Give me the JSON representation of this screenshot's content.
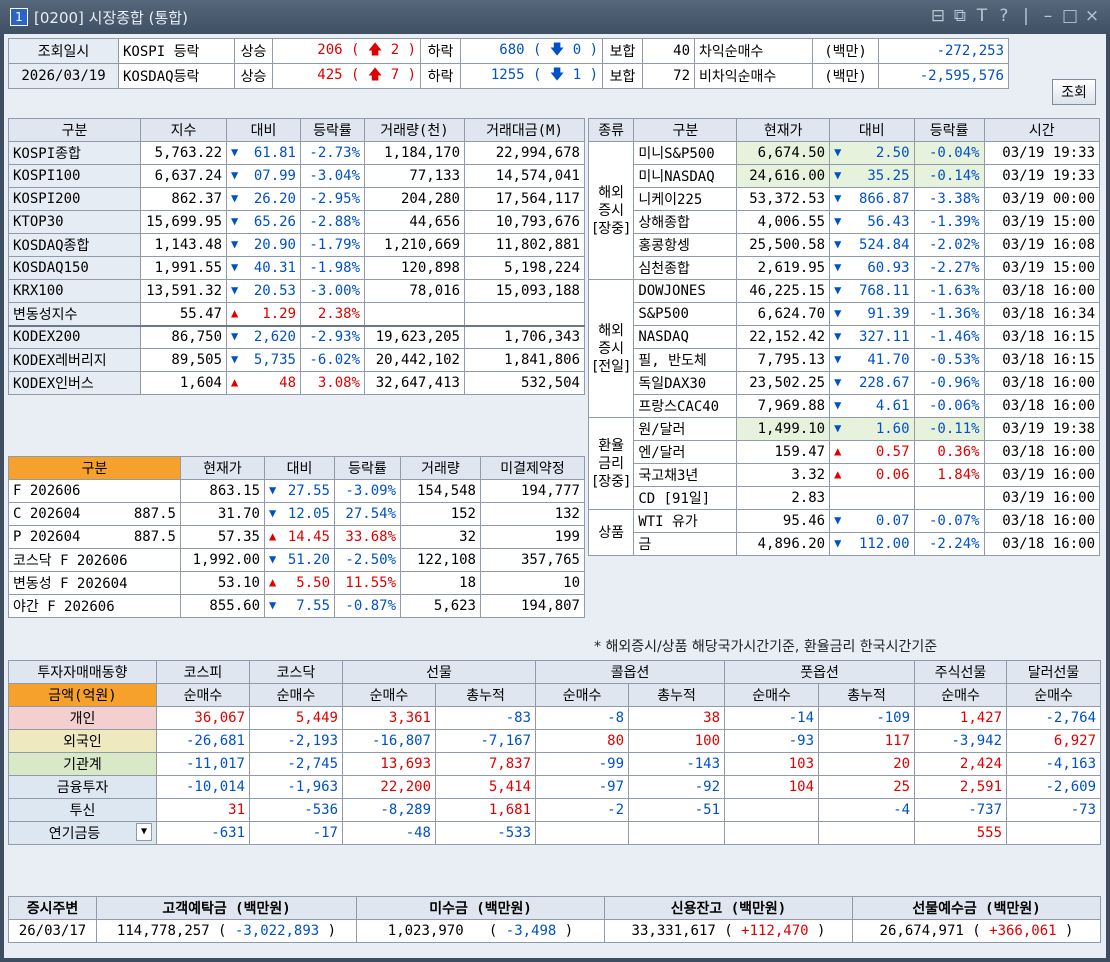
{
  "window": {
    "number": "1",
    "title": "[0200] 시장종합 (통합)"
  },
  "top": {
    "date_label": "조회일시",
    "date_value": "2026/03/19",
    "rows": [
      {
        "name": "KOSPI 등락",
        "up_label": "상승",
        "up": "206",
        "up_chg": "2",
        "down_label": "하락",
        "down": "680",
        "down_chg": "0",
        "flat_label": "보합",
        "flat": "40",
        "arb_label": "차익순매수",
        "arb_unit": "(백만)",
        "arb_value": "-272,253"
      },
      {
        "name": "KOSDAQ등락",
        "up_label": "상승",
        "up": "425",
        "up_chg": "7",
        "down_label": "하락",
        "down": "1255",
        "down_chg": "1",
        "flat_label": "보합",
        "flat": "72",
        "arb_label": "비차익순매수",
        "arb_unit": "(백만)",
        "arb_value": "-2,595,576"
      }
    ],
    "query_button": "조회"
  },
  "index_table": {
    "headers": [
      "구분",
      "지수",
      "대비",
      "등락률",
      "거래량(천)",
      "거래대금(M)"
    ],
    "rows": [
      {
        "name": "KOSPI종합",
        "value": "5,763.22",
        "dir": "down",
        "chg": "61.81",
        "rate": "-2.73%",
        "vol": "1,184,170",
        "amt": "22,994,678"
      },
      {
        "name": "KOSPI100",
        "value": "6,637.24",
        "dir": "down",
        "chg": "07.99",
        "rate": "-3.04%",
        "vol": "77,133",
        "amt": "14,574,041"
      },
      {
        "name": "KOSPI200",
        "value": "862.37",
        "dir": "down",
        "chg": "26.20",
        "rate": "-2.95%",
        "vol": "204,280",
        "amt": "17,564,117"
      },
      {
        "name": "KTOP30",
        "value": "15,699.95",
        "dir": "down",
        "chg": "65.26",
        "rate": "-2.88%",
        "vol": "44,656",
        "amt": "10,793,676"
      },
      {
        "name": "KOSDAQ종합",
        "value": "1,143.48",
        "dir": "down",
        "chg": "20.90",
        "rate": "-1.79%",
        "vol": "1,210,669",
        "amt": "11,802,881"
      },
      {
        "name": "KOSDAQ150",
        "value": "1,991.55",
        "dir": "down",
        "chg": "40.31",
        "rate": "-1.98%",
        "vol": "120,898",
        "amt": "5,198,224"
      },
      {
        "name": "KRX100",
        "value": "13,591.32",
        "dir": "down",
        "chg": "20.53",
        "rate": "-3.00%",
        "vol": "78,016",
        "amt": "15,093,188"
      },
      {
        "name": "변동성지수",
        "value": "55.47",
        "dir": "up",
        "chg": "1.29",
        "rate": "2.38%",
        "vol": "",
        "amt": ""
      },
      {
        "name": "KODEX200",
        "value": "86,750",
        "dir": "down",
        "chg": "2,620",
        "rate": "-2.93%",
        "vol": "19,623,205",
        "amt": "1,706,343"
      },
      {
        "name": "KODEX레버리지",
        "value": "89,505",
        "dir": "down",
        "chg": "5,735",
        "rate": "-6.02%",
        "vol": "20,442,102",
        "amt": "1,841,806"
      },
      {
        "name": "KODEX인버스",
        "value": "1,604",
        "dir": "up",
        "chg": "48",
        "rate": "3.08%",
        "vol": "32,647,413",
        "amt": "532,504"
      }
    ]
  },
  "futures_table": {
    "headers": [
      "구분",
      "현재가",
      "대비",
      "등락률",
      "거래량",
      "미결제약정"
    ],
    "rows": [
      {
        "name": "F 202606",
        "strike": "",
        "value": "863.15",
        "dir": "down",
        "chg": "27.55",
        "rate": "-3.09%",
        "vol": "154,548",
        "oi": "194,777"
      },
      {
        "name": "C 202604",
        "strike": "887.5",
        "value": "31.70",
        "dir": "down",
        "chg": "12.05",
        "rate": "27.54%",
        "vol": "152",
        "oi": "132"
      },
      {
        "name": "P 202604",
        "strike": "887.5",
        "value": "57.35",
        "dir": "up",
        "chg": "14.45",
        "rate": "33.68%",
        "vol": "32",
        "oi": "199"
      },
      {
        "name": "코스닥 F 202606",
        "strike": "",
        "value": "1,992.00",
        "dir": "down",
        "chg": "51.20",
        "rate": "-2.50%",
        "vol": "122,108",
        "oi": "357,765"
      },
      {
        "name": "변동성 F 202604",
        "strike": "",
        "value": "53.10",
        "dir": "up",
        "chg": "5.50",
        "rate": "11.55%",
        "vol": "18",
        "oi": "10"
      },
      {
        "name": "야간 F 202606",
        "strike": "",
        "value": "855.60",
        "dir": "down",
        "chg": "7.55",
        "rate": "-0.87%",
        "vol": "5,623",
        "oi": "194,807"
      }
    ]
  },
  "world_table": {
    "headers": [
      "종류",
      "구분",
      "현재가",
      "대비",
      "등락률",
      "시간"
    ],
    "groups": [
      {
        "label": "해외\n증시\n[장중]",
        "rows": [
          {
            "name": "미니S&P500",
            "value": "6,674.50",
            "dir": "down",
            "chg": "2.50",
            "rate": "-0.04%",
            "time": "03/19 19:33"
          },
          {
            "name": "미니NASDAQ",
            "value": "24,616.00",
            "dir": "down",
            "chg": "35.25",
            "rate": "-0.14%",
            "time": "03/19 19:33"
          },
          {
            "name": "니케이225",
            "value": "53,372.53",
            "dir": "down",
            "chg": "866.87",
            "rate": "-3.38%",
            "time": "03/19 00:00"
          },
          {
            "name": "상해종합",
            "value": "4,006.55",
            "dir": "down",
            "chg": "56.43",
            "rate": "-1.39%",
            "time": "03/19 15:00"
          },
          {
            "name": "홍콩항셍",
            "value": "25,500.58",
            "dir": "down",
            "chg": "524.84",
            "rate": "-2.02%",
            "time": "03/19 16:08"
          },
          {
            "name": "심천종합",
            "value": "2,619.95",
            "dir": "down",
            "chg": "60.93",
            "rate": "-2.27%",
            "time": "03/19 15:00"
          }
        ]
      },
      {
        "label": "해외\n증시\n[전일]",
        "rows": [
          {
            "name": "DOWJONES",
            "value": "46,225.15",
            "dir": "down",
            "chg": "768.11",
            "rate": "-1.63%",
            "time": "03/18 16:00"
          },
          {
            "name": "S&P500",
            "value": "6,624.70",
            "dir": "down",
            "chg": "91.39",
            "rate": "-1.36%",
            "time": "03/18 16:34"
          },
          {
            "name": "NASDAQ",
            "value": "22,152.42",
            "dir": "down",
            "chg": "327.11",
            "rate": "-1.46%",
            "time": "03/18 16:15"
          },
          {
            "name": "필, 반도체",
            "value": "7,795.13",
            "dir": "down",
            "chg": "41.70",
            "rate": "-0.53%",
            "time": "03/18 16:15"
          },
          {
            "name": "독일DAX30",
            "value": "23,502.25",
            "dir": "down",
            "chg": "228.67",
            "rate": "-0.96%",
            "time": "03/18 16:00"
          },
          {
            "name": "프랑스CAC40",
            "value": "7,969.88",
            "dir": "down",
            "chg": "4.61",
            "rate": "-0.06%",
            "time": "03/18 16:00"
          }
        ]
      },
      {
        "label": "환율\n금리\n[장중]",
        "rows": [
          {
            "name": "원/달러",
            "value": "1,499.10",
            "dir": "down",
            "chg": "1.60",
            "rate": "-0.11%",
            "time": "03/19 19:38"
          },
          {
            "name": "엔/달러",
            "value": "159.47",
            "dir": "up",
            "chg": "0.57",
            "rate": "0.36%",
            "time": "03/18 16:00"
          },
          {
            "name": "국고채3년",
            "value": "3.32",
            "dir": "up",
            "chg": "0.06",
            "rate": "1.84%",
            "time": "03/19 16:00"
          },
          {
            "name": "CD [91일]",
            "value": "2.83",
            "dir": "",
            "chg": "",
            "rate": "",
            "time": "03/19 16:00"
          }
        ]
      },
      {
        "label": "상품",
        "rows": [
          {
            "name": "WTI 유가",
            "value": "95.46",
            "dir": "down",
            "chg": "0.07",
            "rate": "-0.07%",
            "time": "03/18 16:00"
          },
          {
            "name": "금",
            "value": "4,896.20",
            "dir": "down",
            "chg": "112.00",
            "rate": "-2.24%",
            "time": "03/18 16:00"
          }
        ]
      }
    ],
    "note": "* 해외증시/상품 해당국가시간기준, 환율금리 한국시간기준"
  },
  "investor_table": {
    "title": "투자자매매동향",
    "unit": "금액(억원)",
    "groups": [
      "코스피",
      "코스닥",
      "선물",
      "콜옵션",
      "풋옵션",
      "주식선물",
      "달러선물"
    ],
    "subheaders": [
      "순매수",
      "순매수",
      "순매수",
      "총누적",
      "순매수",
      "총누적",
      "순매수",
      "총누적",
      "순매수",
      "순매수"
    ],
    "rows": [
      {
        "name": "개인",
        "vals": [
          "36,067",
          "5,449",
          "3,361",
          "-83",
          "-8",
          "38",
          "-14",
          "-109",
          "1,427",
          "-2,764"
        ]
      },
      {
        "name": "외국인",
        "vals": [
          "-26,681",
          "-2,193",
          "-16,807",
          "-7,167",
          "80",
          "100",
          "-93",
          "117",
          "-3,942",
          "6,927"
        ]
      },
      {
        "name": "기관계",
        "vals": [
          "-11,017",
          "-2,745",
          "13,693",
          "7,837",
          "-99",
          "-143",
          "103",
          "20",
          "2,424",
          "-4,163"
        ]
      },
      {
        "name": "금융투자",
        "vals": [
          "-10,014",
          "-1,963",
          "22,200",
          "5,414",
          "-97",
          "-92",
          "104",
          "25",
          "2,591",
          "-2,609"
        ]
      },
      {
        "name": "투신",
        "vals": [
          "31",
          "-536",
          "-8,289",
          "1,681",
          "-2",
          "-51",
          "",
          "-4",
          "-737",
          "-73"
        ]
      },
      {
        "name": "연기금등",
        "vals": [
          "-631",
          "-17",
          "-48",
          "-533",
          "",
          "",
          "",
          "",
          "555",
          ""
        ]
      }
    ]
  },
  "bottom_table": {
    "headers": [
      "증시주변",
      "고객예탁금 (백만원)",
      "미수금 (백만원)",
      "신용잔고 (백만원)",
      "선물예수금 (백만원)"
    ],
    "date": "26/03/17",
    "deposit": "114,778,257",
    "deposit_chg": "-3,022,893",
    "unpaid": "1,023,970",
    "unpaid_chg": "-3,498",
    "credit": "33,331,617",
    "credit_chg": "+112,470",
    "futures_dep": "26,674,971",
    "futures_dep_chg": "+366,061"
  }
}
